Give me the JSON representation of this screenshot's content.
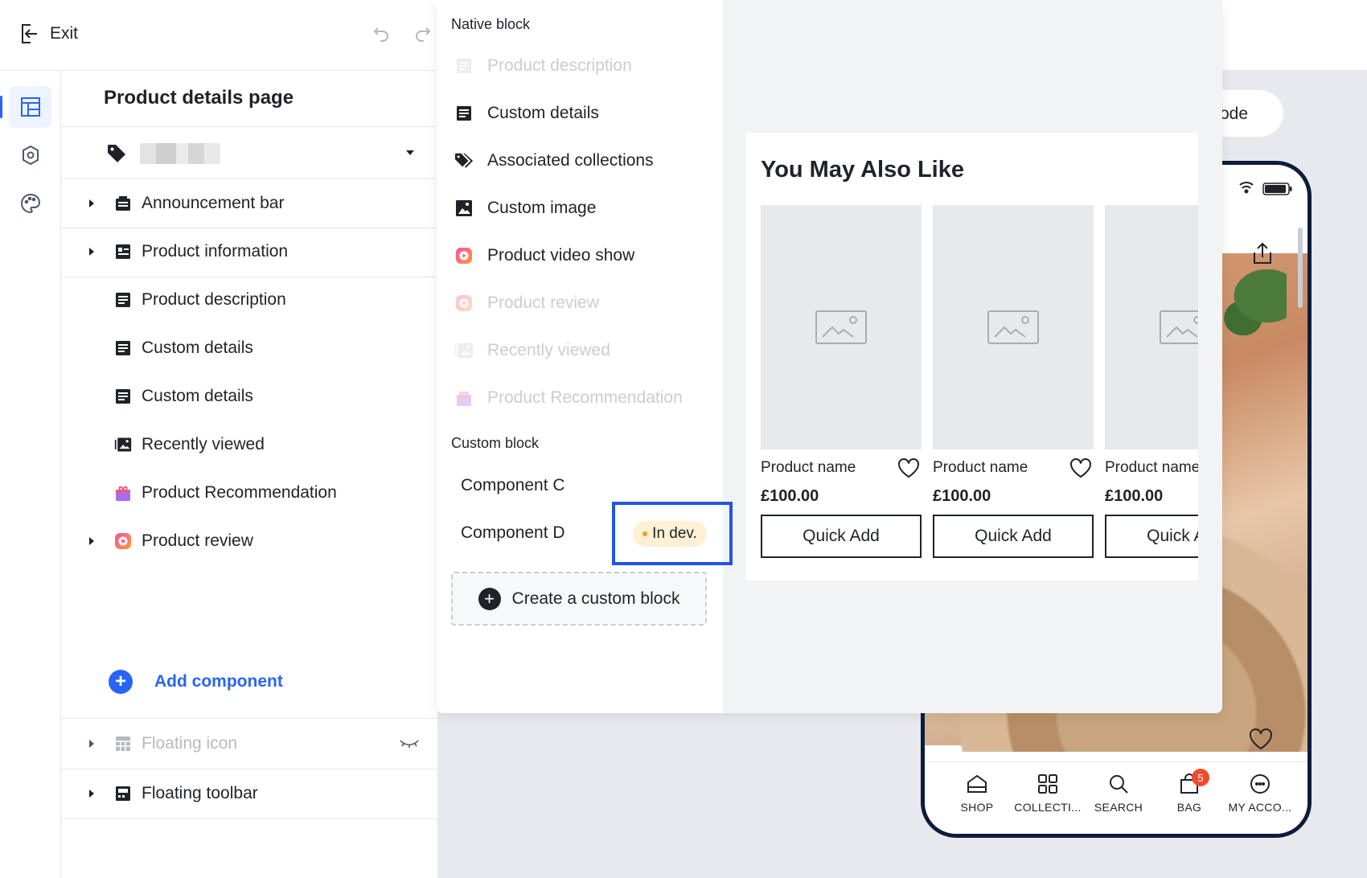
{
  "topbar": {
    "exit_label": "Exit"
  },
  "sidebar": {
    "page_title": "Product details page",
    "tree": [
      {
        "label": "Announcement bar",
        "expandable": true,
        "dim": false,
        "icon": "announcement-icon"
      },
      {
        "label": "Product information",
        "expandable": true,
        "dim": false,
        "icon": "product-info-icon"
      },
      {
        "label": "Product description",
        "expandable": false,
        "dim": false,
        "icon": "document-icon"
      },
      {
        "label": "Custom details",
        "expandable": false,
        "dim": false,
        "icon": "document-icon"
      },
      {
        "label": "Custom details",
        "expandable": false,
        "dim": false,
        "icon": "document-icon"
      },
      {
        "label": "Recently viewed",
        "expandable": false,
        "dim": false,
        "icon": "gallery-icon"
      },
      {
        "label": "Product Recommendation",
        "expandable": false,
        "dim": false,
        "icon": "gift-icon"
      },
      {
        "label": "Product review",
        "expandable": true,
        "dim": false,
        "icon": "review-icon"
      }
    ],
    "add_component_label": "Add component",
    "bottom_tree": [
      {
        "label": "Floating icon",
        "expandable": true,
        "dim": true,
        "icon": "grid-icon"
      },
      {
        "label": "Floating toolbar",
        "expandable": true,
        "dim": false,
        "icon": "toolbar-icon"
      }
    ]
  },
  "popup": {
    "native_title": "Native block",
    "native_blocks": [
      {
        "label": "Product description",
        "disabled": true,
        "icon": "document-icon"
      },
      {
        "label": "Custom details",
        "disabled": false,
        "icon": "document-icon"
      },
      {
        "label": "Associated collections",
        "disabled": false,
        "icon": "tags-icon"
      },
      {
        "label": "Custom image",
        "disabled": false,
        "icon": "image-icon"
      },
      {
        "label": "Product video show",
        "disabled": false,
        "icon": "video-icon"
      },
      {
        "label": "Product review",
        "disabled": true,
        "icon": "review-icon"
      },
      {
        "label": "Recently viewed",
        "disabled": true,
        "icon": "gallery-icon"
      },
      {
        "label": "Product Recommendation",
        "disabled": true,
        "icon": "gift-icon"
      }
    ],
    "custom_title": "Custom block",
    "custom_blocks": [
      "Component C",
      "Component D"
    ],
    "badge_label": "In dev.",
    "create_label": "Create a custom block"
  },
  "preview": {
    "title": "You May Also Like",
    "products": [
      {
        "name": "Product name",
        "price": "£100.00",
        "button": "Quick Add"
      },
      {
        "name": "Product name",
        "price": "£100.00",
        "button": "Quick Add"
      },
      {
        "name": "Product name",
        "price": "£100.00",
        "button": "Quick Add"
      }
    ]
  },
  "background": {
    "mode_text": "ode",
    "nav": [
      {
        "label": "SHOP",
        "icon": "home-icon"
      },
      {
        "label": "COLLECTI...",
        "icon": "grid-icon"
      },
      {
        "label": "SEARCH",
        "icon": "search-icon"
      },
      {
        "label": "BAG",
        "icon": "bag-icon",
        "badge": "5"
      },
      {
        "label": "MY ACCO...",
        "icon": "account-icon"
      }
    ]
  },
  "colors": {
    "accent": "#2a64f6",
    "highlight_border": "#2154e8",
    "badge_bg": "#fdf0d5",
    "bag_badge": "#ee4d2d"
  }
}
